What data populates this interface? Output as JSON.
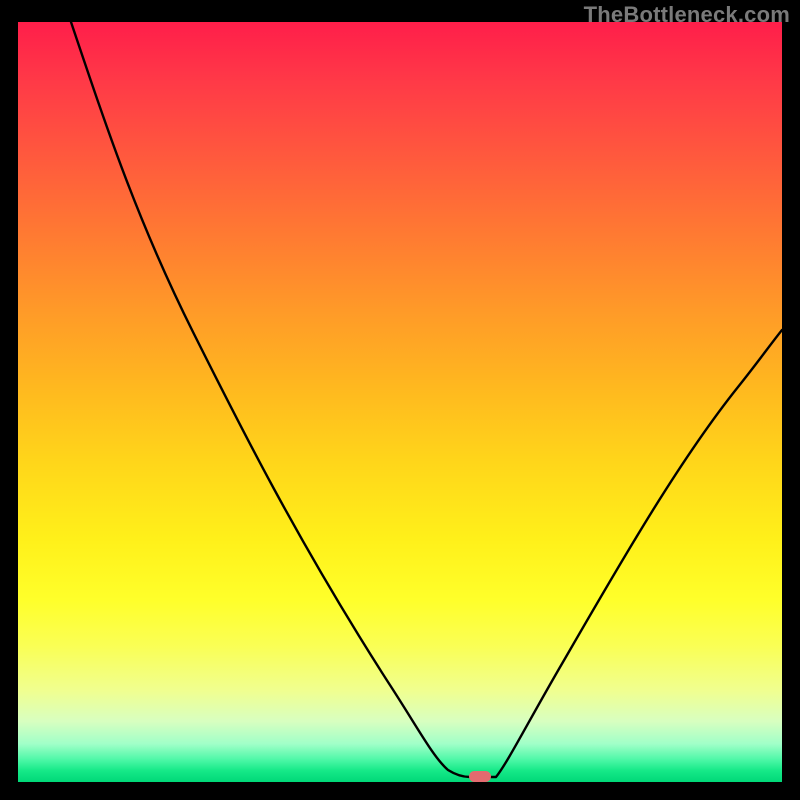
{
  "watermark": "TheBottleneck.com",
  "chart_data": {
    "type": "line",
    "title": "",
    "xlabel": "",
    "ylabel": "",
    "xlim": [
      0,
      100
    ],
    "ylim": [
      0,
      100
    ],
    "grid": false,
    "legend": false,
    "series": [
      {
        "name": "bottleneck_curve",
        "x": [
          7,
          15,
          25,
          35,
          45,
          54,
          57,
          59,
          62,
          70,
          80,
          90,
          100
        ],
        "y": [
          100,
          82,
          63,
          46,
          30,
          13,
          3,
          0.5,
          0.5,
          12,
          30,
          46,
          60
        ]
      }
    ],
    "marker": {
      "x": 60.2,
      "y": 0.5,
      "shape": "pill",
      "color": "#e46a6f"
    },
    "gradient_stops": [
      {
        "pos": 0,
        "color": "#ff1e4a"
      },
      {
        "pos": 0.5,
        "color": "#ffe01a"
      },
      {
        "pos": 0.95,
        "color": "#50f8a8"
      },
      {
        "pos": 1.0,
        "color": "#00d878"
      }
    ]
  }
}
